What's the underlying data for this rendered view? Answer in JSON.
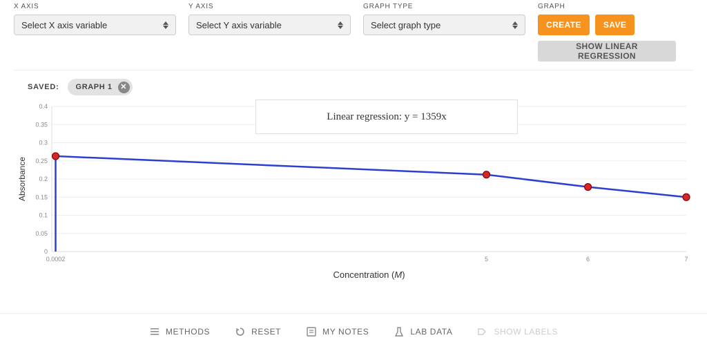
{
  "controls": {
    "xaxis": {
      "label": "X AXIS",
      "value": "Select X axis variable"
    },
    "yaxis": {
      "label": "Y AXIS",
      "value": "Select Y axis variable"
    },
    "gtype": {
      "label": "GRAPH TYPE",
      "value": "Select graph type"
    },
    "graph": {
      "label": "GRAPH",
      "create": "CREATE",
      "save": "SAVE",
      "regression": "SHOW LINEAR REGRESSION"
    }
  },
  "saved": {
    "label": "SAVED:",
    "chip": "GRAPH 1",
    "chip_close": "✕"
  },
  "regression_text": "Linear regression: y = 1359x",
  "chart_data": {
    "type": "line",
    "title": "",
    "xlabel": "Concentration (M)",
    "ylabel": "Absorbance",
    "ylim": [
      0,
      0.4
    ],
    "yticks": [
      0,
      0.05,
      0.1,
      0.15,
      0.2,
      0.25,
      0.3,
      0.35,
      0.4
    ],
    "xticks": [
      "0.0002",
      "5",
      "6",
      "7"
    ],
    "x": [
      0.0002,
      5,
      6,
      7
    ],
    "values": [
      0.263,
      0.212,
      0.178,
      0.15
    ]
  },
  "footer": {
    "methods": "METHODS",
    "reset": "RESET",
    "notes": "MY NOTES",
    "labdata": "LAB DATA",
    "labels": "SHOW LABELS"
  }
}
